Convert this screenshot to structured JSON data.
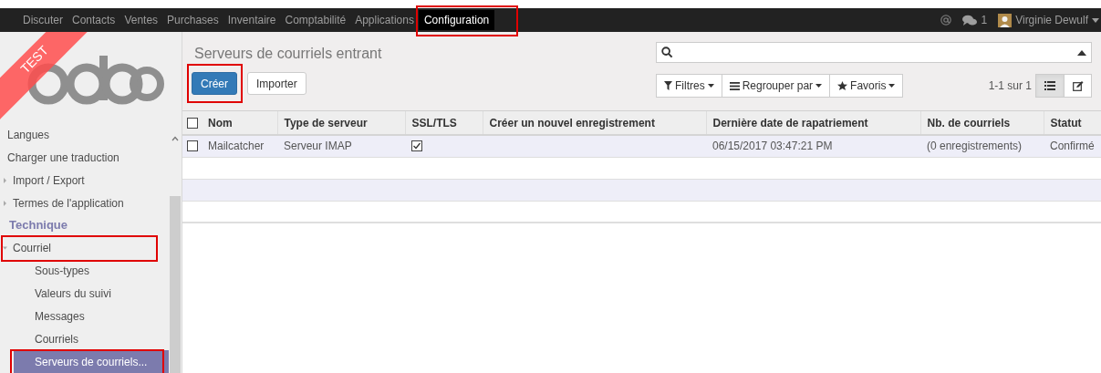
{
  "top_menu": [
    {
      "label": "Discuter",
      "selected": false,
      "highlighted": false
    },
    {
      "label": "Contacts",
      "selected": false,
      "highlighted": false
    },
    {
      "label": "Ventes",
      "selected": false,
      "highlighted": false
    },
    {
      "label": "Purchases",
      "selected": false,
      "highlighted": false
    },
    {
      "label": "Inventaire",
      "selected": false,
      "highlighted": false
    },
    {
      "label": "Comptabilité",
      "selected": false,
      "highlighted": false
    },
    {
      "label": "Applications",
      "selected": false,
      "highlighted": false
    },
    {
      "label": "Configuration",
      "selected": true,
      "highlighted": true
    }
  ],
  "systray": {
    "messages_count": "1",
    "user": "Virginie Dewulf"
  },
  "ribbon": "TEST",
  "sidebar": {
    "items": [
      {
        "kind": "item",
        "label": "Langues",
        "selected": false,
        "highlighted": false
      },
      {
        "kind": "item",
        "label": "Charger une traduction",
        "selected": false,
        "highlighted": false
      },
      {
        "kind": "folder",
        "label": "Import / Export",
        "expanded": false,
        "selected": false,
        "highlighted": false
      },
      {
        "kind": "folder",
        "label": "Termes de l'application",
        "expanded": false,
        "selected": false,
        "highlighted": false
      },
      {
        "kind": "header",
        "label": "Technique"
      },
      {
        "kind": "folder",
        "label": "Courriel",
        "expanded": true,
        "selected": false,
        "highlighted": true,
        "children": [
          {
            "kind": "item",
            "label": "Sous-types",
            "selected": false,
            "highlighted": false
          },
          {
            "kind": "item",
            "label": "Valeurs du suivi",
            "selected": false,
            "highlighted": false
          },
          {
            "kind": "item",
            "label": "Messages",
            "selected": false,
            "highlighted": false
          },
          {
            "kind": "item",
            "label": "Courriels",
            "selected": false,
            "highlighted": false
          },
          {
            "kind": "item",
            "label": "Serveurs de courriels...",
            "selected": true,
            "highlighted": true
          }
        ]
      }
    ]
  },
  "title": "Serveurs de courriels entrant",
  "buttons": [
    {
      "label": "Créer",
      "kind": "primary",
      "highlighted": true
    },
    {
      "label": "Importer",
      "kind": "default",
      "highlighted": false
    }
  ],
  "search_options": [
    "Filtres",
    "Regrouper par",
    "Favoris"
  ],
  "pager": "1-1 sur 1",
  "views": [
    {
      "kind": "list",
      "selected": true
    },
    {
      "kind": "form",
      "selected": false
    }
  ],
  "table": {
    "all_checked": false,
    "columns": [
      "Nom",
      "Type de serveur",
      "SSL/TLS",
      "Créer un nouvel enregistrement",
      "Dernière date de rapatriement",
      "Nb. de courriels",
      "Statut"
    ],
    "rows": [
      {
        "checked": false,
        "cells": [
          "Mailcatcher",
          "Serveur IMAP",
          {
            "checked": true
          },
          "",
          "06/15/2017 03:47:21 PM",
          "(0 enregistrements)",
          "Confirmé"
        ]
      }
    ]
  }
}
